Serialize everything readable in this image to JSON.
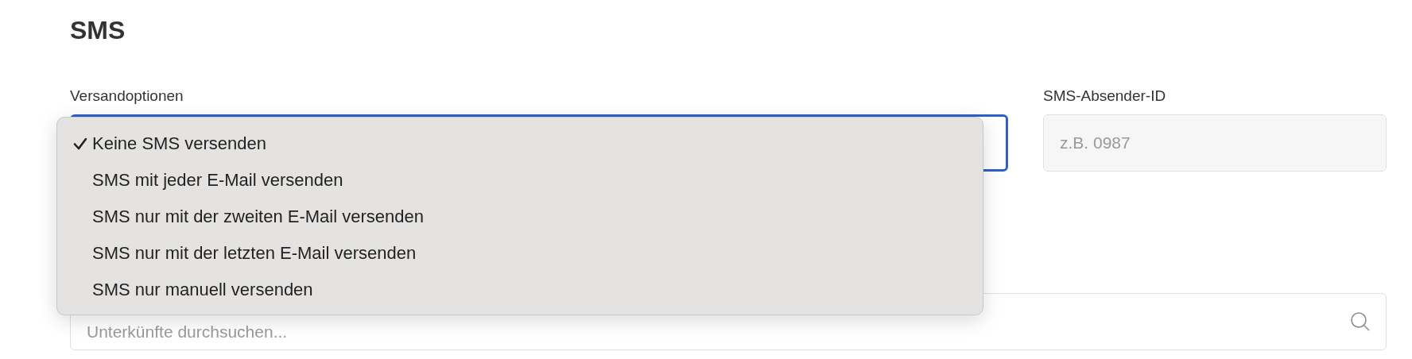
{
  "heading": "SMS",
  "shipping": {
    "label": "Versandoptionen",
    "focused": true,
    "menu": [
      {
        "label": "Keine SMS versenden",
        "selected": true
      },
      {
        "label": "SMS mit jeder E-Mail versenden",
        "selected": false
      },
      {
        "label": "SMS nur mit der zweiten E-Mail versenden",
        "selected": false
      },
      {
        "label": "SMS nur mit der letzten E-Mail versenden",
        "selected": false
      },
      {
        "label": "SMS nur manuell versenden",
        "selected": false
      }
    ]
  },
  "sender_id": {
    "label": "SMS-Absender-ID",
    "placeholder": "z.B. 0987"
  },
  "search": {
    "placeholder": "Unterkünfte durchsuchen..."
  }
}
